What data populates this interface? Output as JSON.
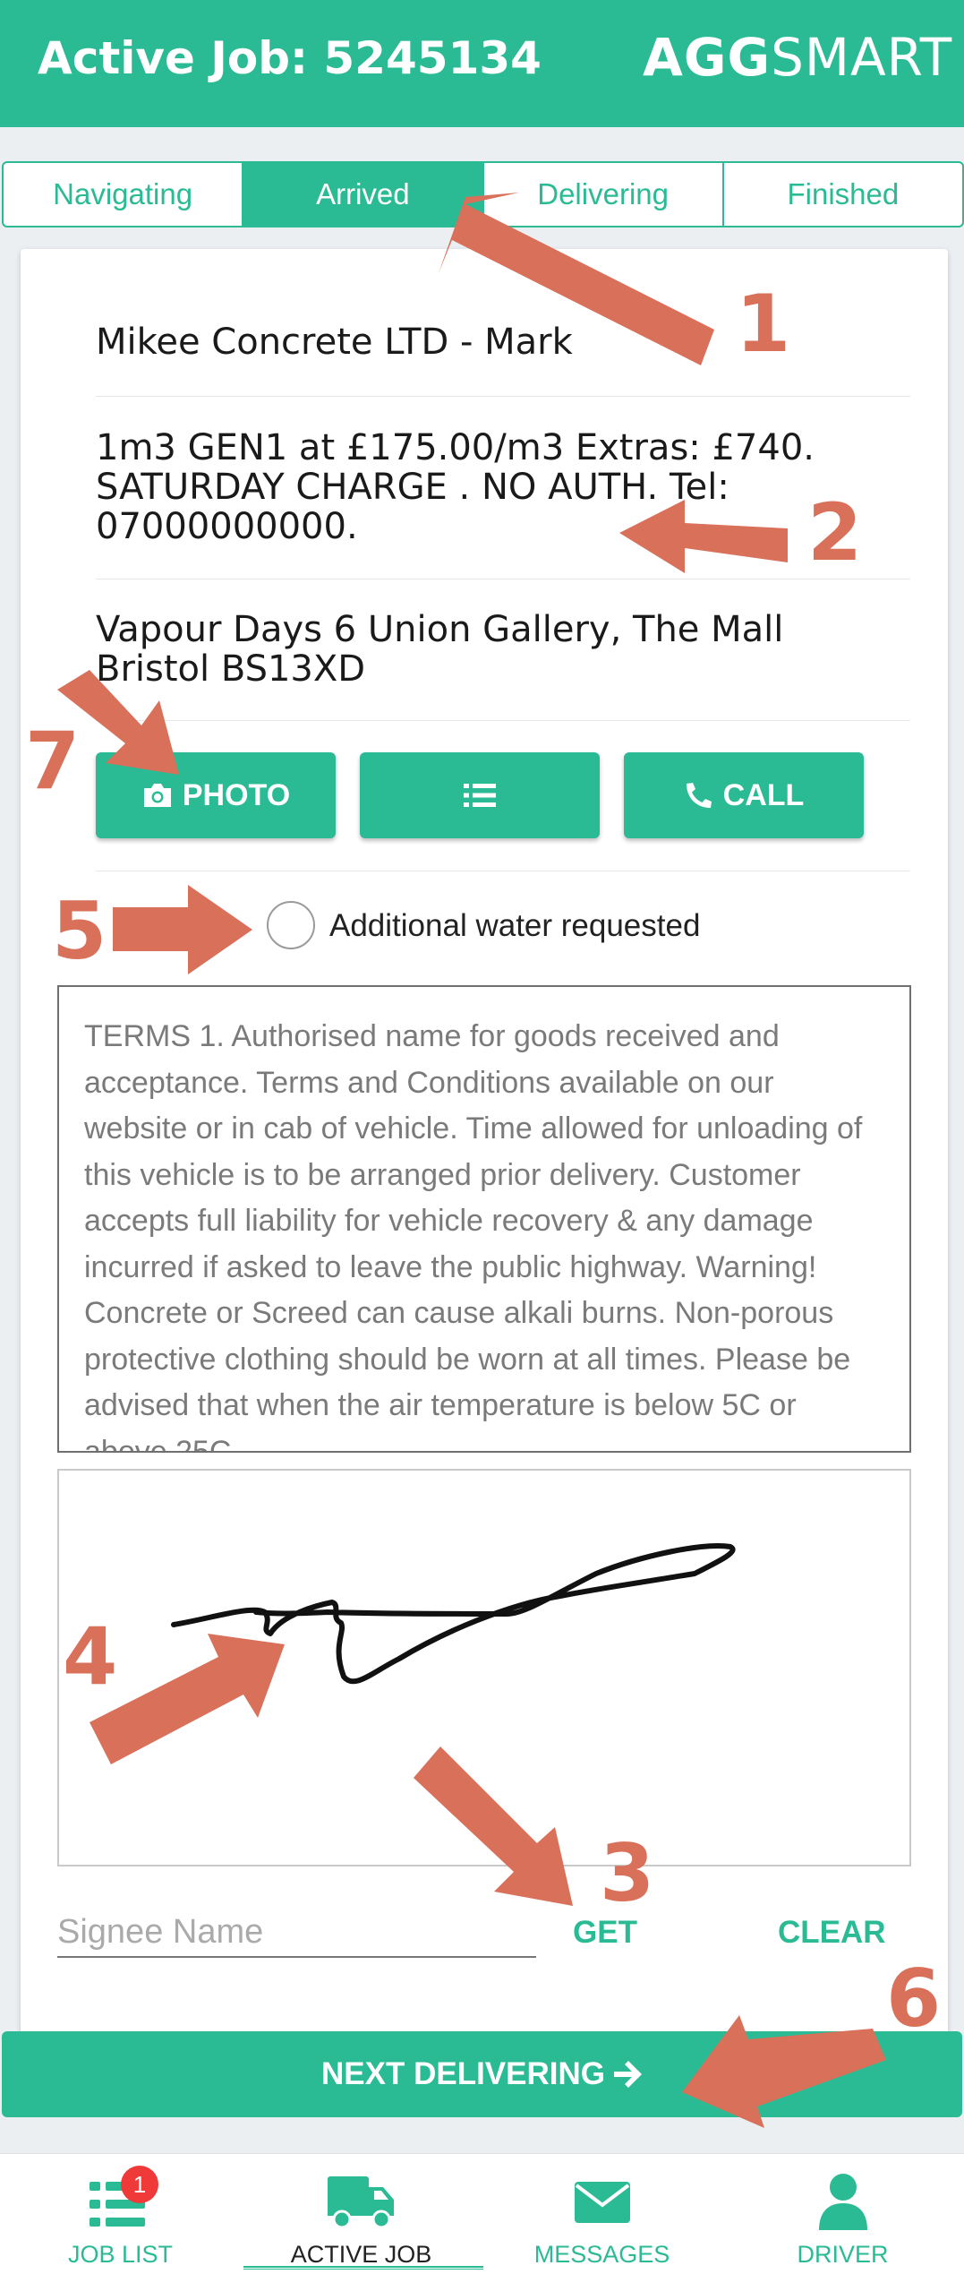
{
  "header": {
    "title": "Active Job: 5245134",
    "brand_bold": "AGG",
    "brand_light": "SMART"
  },
  "tabs": [
    {
      "label": "Navigating",
      "active": false
    },
    {
      "label": "Arrived",
      "active": true
    },
    {
      "label": "Delivering",
      "active": false
    },
    {
      "label": "Finished",
      "active": false
    }
  ],
  "job": {
    "customer": "Mikee Concrete LTD - Mark",
    "description": "1m3 GEN1 at £175.00/m3 Extras: £740. SATURDAY CHARGE . NO AUTH. Tel: 07000000000.",
    "address": "Vapour Days 6 Union Gallery, The Mall Bristol BS13XD"
  },
  "actions": {
    "photo_label": "PHOTO",
    "list_icon": "list-icon",
    "call_label": "CALL"
  },
  "water": {
    "label": "Additional water requested",
    "checked": false
  },
  "terms": "TERMS 1. Authorised name for goods received and acceptance. Terms and Conditions available on our website or in cab of vehicle. Time allowed for unloading of this vehicle is to be arranged prior delivery. Customer accepts full liability for vehicle recovery & any damage incurred if asked to leave the public highway. Warning! Concrete or Screed can cause alkali burns. Non-porous protective clothing should be worn at all times. Please be advised that when the air temperature is below 5C or above 25C",
  "signature": {
    "signee_placeholder": "Signee Name",
    "get_label": "GET",
    "clear_label": "CLEAR"
  },
  "next_button": "NEXT DELIVERING",
  "bottom_nav": [
    {
      "label": "JOB LIST",
      "icon": "list-icon",
      "badge": "1"
    },
    {
      "label": "ACTIVE JOB",
      "icon": "truck-icon",
      "active": true
    },
    {
      "label": "MESSAGES",
      "icon": "envelope-icon"
    },
    {
      "label": "DRIVER",
      "icon": "user-icon"
    }
  ],
  "annotations": [
    "1",
    "2",
    "3",
    "4",
    "5",
    "6",
    "7"
  ],
  "colors": {
    "primary": "#2bbb94",
    "annotation": "#d9705a",
    "badge": "#f03a3a"
  }
}
